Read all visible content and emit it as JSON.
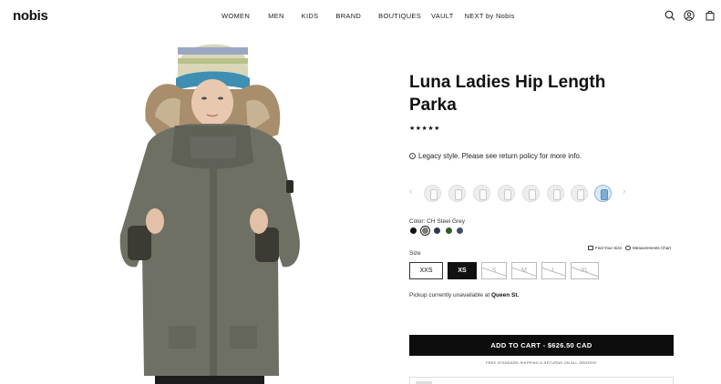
{
  "header": {
    "logo": "nobis",
    "nav": [
      "WOMEN",
      "MEN",
      "KIDS",
      "BRAND",
      "BOUTIQUES",
      "VAULT",
      "NEXT by Nobis"
    ],
    "icons": [
      "search-icon",
      "account-icon",
      "bag-icon"
    ]
  },
  "product": {
    "title": "Luna Ladies Hip Length Parka",
    "rating_stars": "★★★★★",
    "rating_value": 5,
    "notice": "Legacy style. Please see return policy for more info.",
    "feature_icons": [
      "feature-icon-1",
      "feature-icon-2",
      "feature-icon-3",
      "feature-icon-4",
      "feature-icon-5",
      "feature-icon-6",
      "feature-icon-7",
      "feature-icon-8"
    ],
    "color_label": "Color: CH Steel Grey",
    "colors": [
      {
        "name": "black",
        "hex": "#111111"
      },
      {
        "name": "ch-steel-grey",
        "hex": "#7a7a72",
        "selected": true
      },
      {
        "name": "navy",
        "hex": "#2a3a55"
      },
      {
        "name": "green",
        "hex": "#2f5b2a"
      },
      {
        "name": "slate-blue",
        "hex": "#3d4c6e"
      }
    ],
    "size_label": "Size",
    "find_your_size": "Find Your Size",
    "measurements_chart": "Measurements Chart",
    "sizes": [
      {
        "label": "XXS",
        "state": "available"
      },
      {
        "label": "XS",
        "state": "selected"
      },
      {
        "label": "S",
        "state": "unavailable"
      },
      {
        "label": "M",
        "state": "unavailable"
      },
      {
        "label": "L",
        "state": "unavailable"
      },
      {
        "label": "XL",
        "state": "unavailable"
      }
    ],
    "pickup_prefix": "Pickup currently unavailable at",
    "pickup_store": "Queen St.",
    "cart_button": "ADD TO CART - $626.50 CAD",
    "shipping_note": "FREE STANDARD SHIPPING & RETURNS ON ALL ORDERS*"
  },
  "colors": {
    "accent": "#0d0d0d",
    "jacket": "#6f7064"
  }
}
